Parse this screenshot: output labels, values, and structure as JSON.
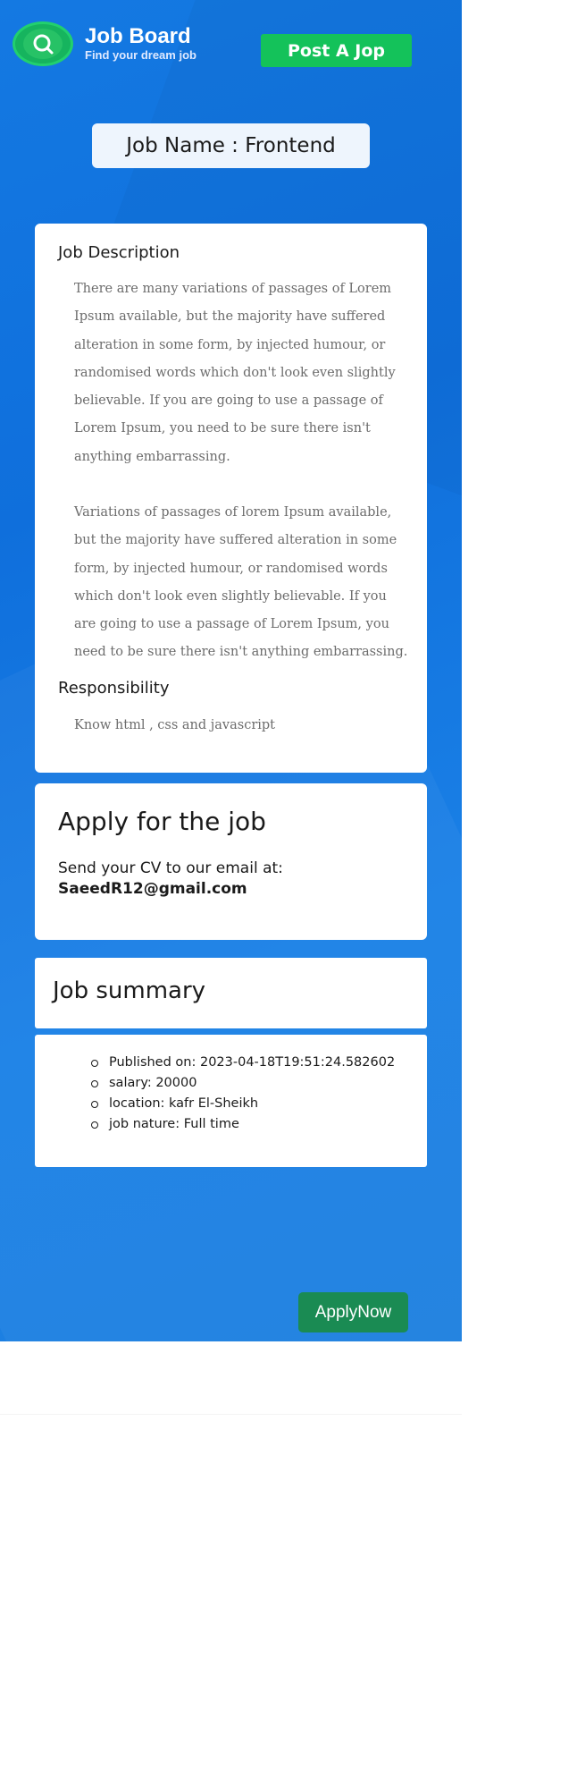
{
  "header": {
    "brand_title": "Job Board",
    "brand_subtitle": "Find your dream job",
    "post_button": "Post A Jop",
    "logo_icon": "search-icon"
  },
  "job": {
    "name_label": "Job Name : Frontend"
  },
  "description": {
    "heading": "Job Description",
    "paragraph_1": "There are many variations of passages of Lorem Ipsum available, but the majority have suffered alteration in some form, by injected humour, or randomised words which don't look even slightly believable. If you are going to use a passage of Lorem Ipsum, you need to be sure there isn't anything embarrassing.",
    "paragraph_2": "Variations of passages of lorem Ipsum available, but the majority have suffered alteration in some form, by injected humour, or randomised words which don't look even slightly believable. If you are going to use a passage of Lorem Ipsum, you need to be sure there isn't anything embarrassing.",
    "responsibility_heading": "Responsibility",
    "responsibility_text": "Know html , css and javascript"
  },
  "apply": {
    "title": "Apply for the job",
    "text": "Send your CV to our email at:",
    "email": "SaeedR12@gmail.com"
  },
  "summary": {
    "title": "Job summary",
    "items": [
      "Published on: 2023-04-18T19:51:24.582602",
      "salary: 20000",
      "location: kafr El-Sheikh",
      "job nature: Full time"
    ]
  },
  "actions": {
    "apply_now": "ApplyNow"
  },
  "colors": {
    "background": "#1479e2",
    "post_button": "#14c25a",
    "apply_now_button": "#1a8b53"
  }
}
